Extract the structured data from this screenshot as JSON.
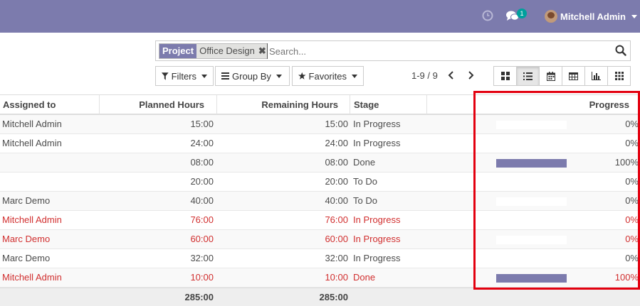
{
  "navbar": {
    "color": "#7c7bad",
    "icons": [
      "clock-icon",
      "chat-icon"
    ],
    "chat_badge": "1",
    "user_name": "Mitchell Admin"
  },
  "search": {
    "facet_category": "Project",
    "facet_value": "Office Design",
    "placeholder": "Search..."
  },
  "toolbar": {
    "filters_label": "Filters",
    "groupby_label": "Group By",
    "favorites_label": "Favorites",
    "pager": "1-9 / 9",
    "views": [
      "kanban-view",
      "list-view",
      "calendar-view",
      "pivot-view",
      "graph-view",
      "grid-view"
    ],
    "active_view": "list-view"
  },
  "table": {
    "headers": {
      "assigned": "Assigned to",
      "planned": "Planned Hours",
      "remaining": "Remaining Hours",
      "stage": "Stage",
      "progress": "Progress"
    },
    "rows": [
      {
        "assigned": "Mitchell Admin",
        "planned": "15:00",
        "remaining": "15:00",
        "stage": "In Progress",
        "progress_label": "0%",
        "progress": 0,
        "overdue": false
      },
      {
        "assigned": "Mitchell Admin",
        "planned": "24:00",
        "remaining": "24:00",
        "stage": "In Progress",
        "progress_label": "0%",
        "progress": 0,
        "overdue": false
      },
      {
        "assigned": "",
        "planned": "08:00",
        "remaining": "08:00",
        "stage": "Done",
        "progress_label": "100%",
        "progress": 100,
        "overdue": false
      },
      {
        "assigned": "",
        "planned": "20:00",
        "remaining": "20:00",
        "stage": "To Do",
        "progress_label": "0%",
        "progress": 0,
        "overdue": false
      },
      {
        "assigned": "Marc Demo",
        "planned": "40:00",
        "remaining": "40:00",
        "stage": "To Do",
        "progress_label": "0%",
        "progress": 0,
        "overdue": false
      },
      {
        "assigned": "Mitchell Admin",
        "planned": "76:00",
        "remaining": "76:00",
        "stage": "In Progress",
        "progress_label": "0%",
        "progress": 0,
        "overdue": true
      },
      {
        "assigned": "Marc Demo",
        "planned": "60:00",
        "remaining": "60:00",
        "stage": "In Progress",
        "progress_label": "0%",
        "progress": 0,
        "overdue": true
      },
      {
        "assigned": "Marc Demo",
        "planned": "32:00",
        "remaining": "32:00",
        "stage": "In Progress",
        "progress_label": "0%",
        "progress": 0,
        "overdue": false
      },
      {
        "assigned": "Mitchell Admin",
        "planned": "10:00",
        "remaining": "10:00",
        "stage": "Done",
        "progress_label": "100%",
        "progress": 100,
        "overdue": true
      }
    ],
    "totals": {
      "planned": "285:00",
      "remaining": "285:00"
    }
  },
  "colors": {
    "accent": "#7c7bad",
    "overdue": "#d12f2f",
    "highlight": "#e3000f"
  }
}
